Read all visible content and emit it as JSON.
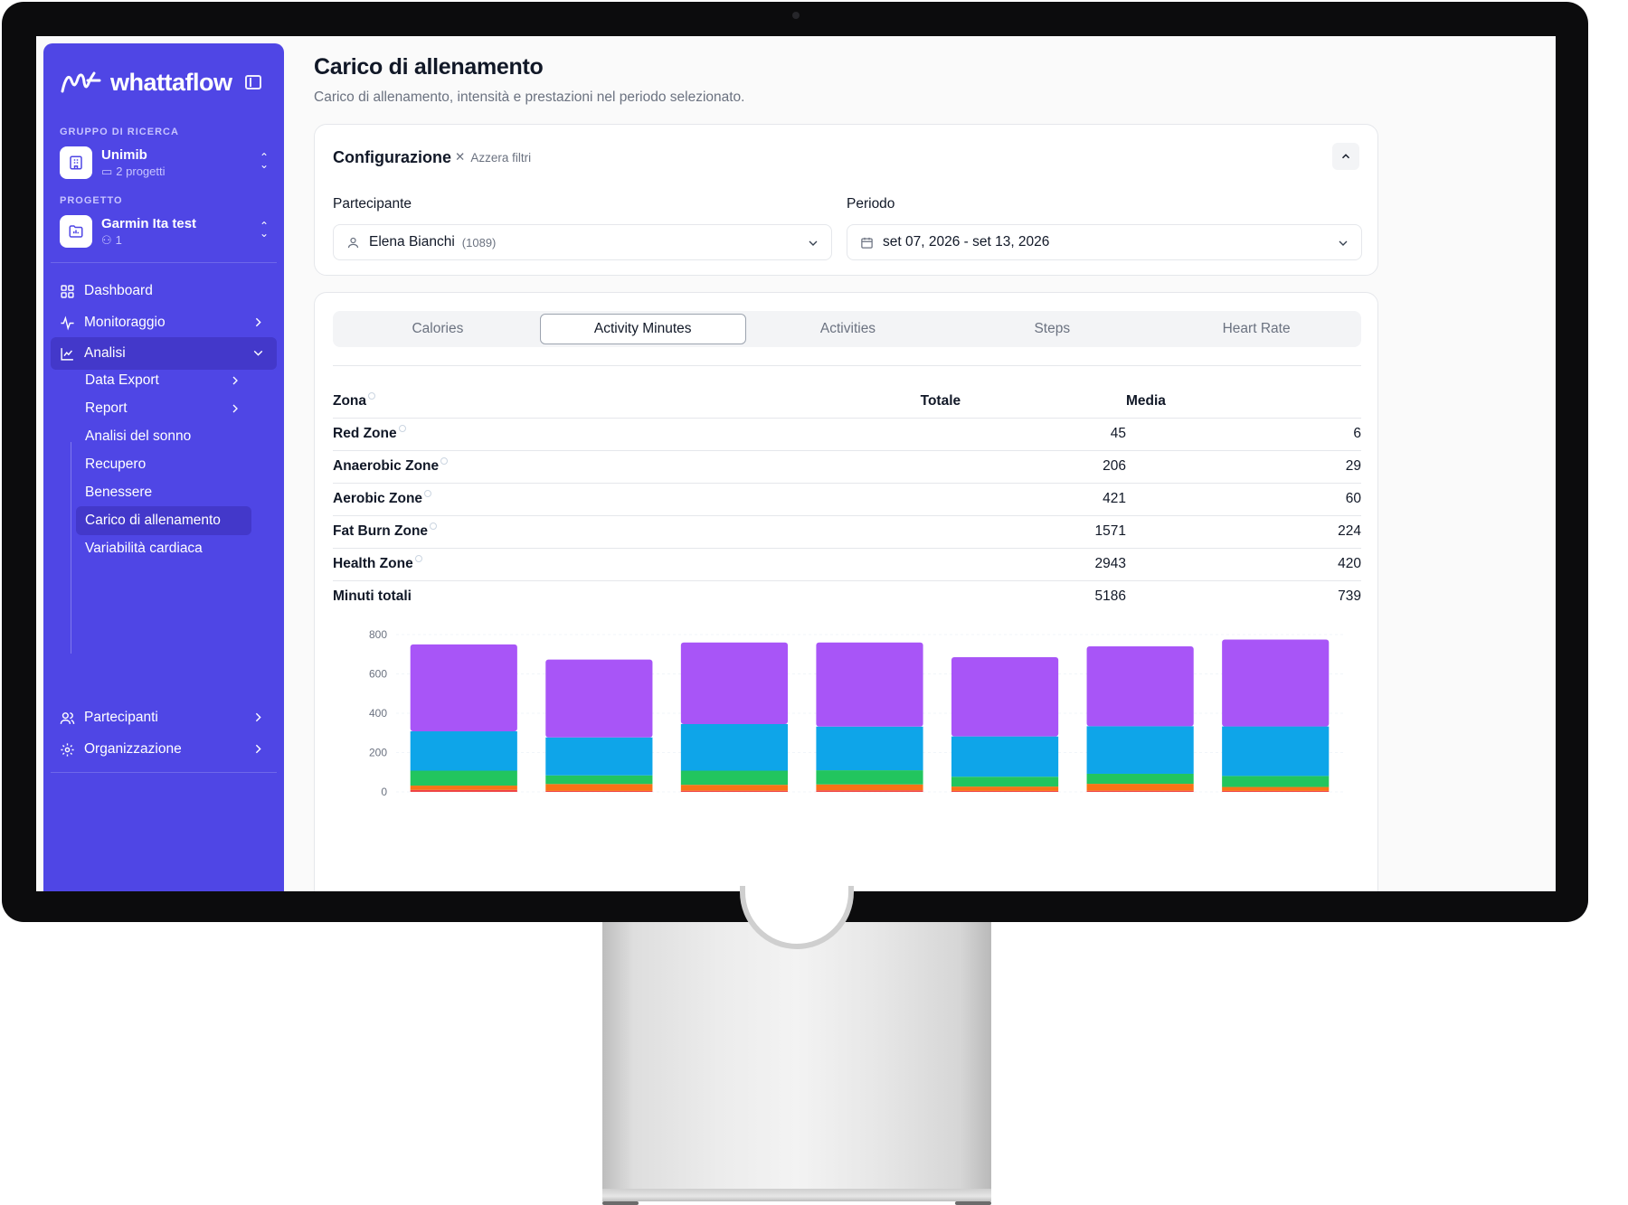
{
  "brand": {
    "name": "whattaflow"
  },
  "sidebar": {
    "group_label": "GRUPPO DI RICERCA",
    "group": {
      "name": "Unimib",
      "meta": "2 progetti"
    },
    "project_label": "PROGETTO",
    "project": {
      "name": "Garmin Ita test",
      "meta": "1"
    },
    "nav": [
      {
        "label": "Dashboard",
        "icon": "grid-icon"
      },
      {
        "label": "Monitoraggio",
        "icon": "activity-icon"
      },
      {
        "label": "Analisi",
        "icon": "chart-line-icon",
        "expanded": true
      }
    ],
    "analisi_items": [
      {
        "label": "Data Export",
        "has_children": true
      },
      {
        "label": "Report",
        "has_children": true
      },
      {
        "label": "Analisi del sonno"
      },
      {
        "label": "Recupero"
      },
      {
        "label": "Benessere"
      },
      {
        "label": "Carico di allenamento",
        "active": true
      },
      {
        "label": "Variabilità cardiaca"
      }
    ],
    "bottom_nav": [
      {
        "label": "Partecipanti",
        "icon": "users-icon"
      },
      {
        "label": "Organizzazione",
        "icon": "gear-icon"
      }
    ]
  },
  "page": {
    "title": "Carico di allenamento",
    "subtitle": "Carico di allenamento, intensità e prestazioni nel periodo selezionato."
  },
  "config": {
    "title": "Configurazione",
    "reset_label": "Azzera filtri",
    "participant_label": "Partecipante",
    "participant_value": "Elena Bianchi",
    "participant_id": "(1089)",
    "period_label": "Periodo",
    "period_value": "set 07, 2026 - set 13, 2026"
  },
  "tabs": [
    "Calories",
    "Activity Minutes",
    "Activities",
    "Steps",
    "Heart Rate"
  ],
  "active_tab": "Activity Minutes",
  "table": {
    "headers": {
      "zone": "Zona",
      "total": "Totale",
      "avg": "Media"
    },
    "rows": [
      {
        "zone": "Red Zone",
        "total": "45",
        "avg": "6",
        "info": true
      },
      {
        "zone": "Anaerobic Zone",
        "total": "206",
        "avg": "29",
        "info": true
      },
      {
        "zone": "Aerobic Zone",
        "total": "421",
        "avg": "60",
        "info": true
      },
      {
        "zone": "Fat Burn Zone",
        "total": "1571",
        "avg": "224",
        "info": true
      },
      {
        "zone": "Health Zone",
        "total": "2943",
        "avg": "420",
        "info": true
      },
      {
        "zone": "Minuti totali",
        "total": "5186",
        "avg": "739",
        "info": false
      }
    ]
  },
  "colors": {
    "sidebar": "#4f46e5",
    "red_zone": "#ef4444",
    "anaerobic_zone": "#f97316",
    "aerobic_zone": "#22c55e",
    "fat_burn_zone": "#0ea5e9",
    "health_zone": "#a855f7"
  },
  "chart_data": {
    "type": "bar",
    "stacked": true,
    "ylim": [
      0,
      800
    ],
    "yticks": [
      0,
      200,
      400,
      600,
      800
    ],
    "categories": [
      "",
      "",
      "",
      "",
      "",
      "",
      ""
    ],
    "series": [
      {
        "name": "Red Zone",
        "color": "#ef4444",
        "values": [
          10,
          5,
          6,
          8,
          5,
          6,
          5
        ]
      },
      {
        "name": "Anaerobic Zone",
        "color": "#f97316",
        "values": [
          22,
          35,
          30,
          30,
          22,
          35,
          20
        ]
      },
      {
        "name": "Aerobic Zone",
        "color": "#22c55e",
        "values": [
          76,
          44,
          72,
          72,
          50,
          51,
          56
        ]
      },
      {
        "name": "Fat Burn Zone",
        "color": "#0ea5e9",
        "values": [
          200,
          193,
          237,
          222,
          205,
          242,
          252
        ]
      },
      {
        "name": "Health Zone",
        "color": "#a855f7",
        "values": [
          442,
          396,
          415,
          428,
          403,
          406,
          442
        ]
      }
    ]
  }
}
